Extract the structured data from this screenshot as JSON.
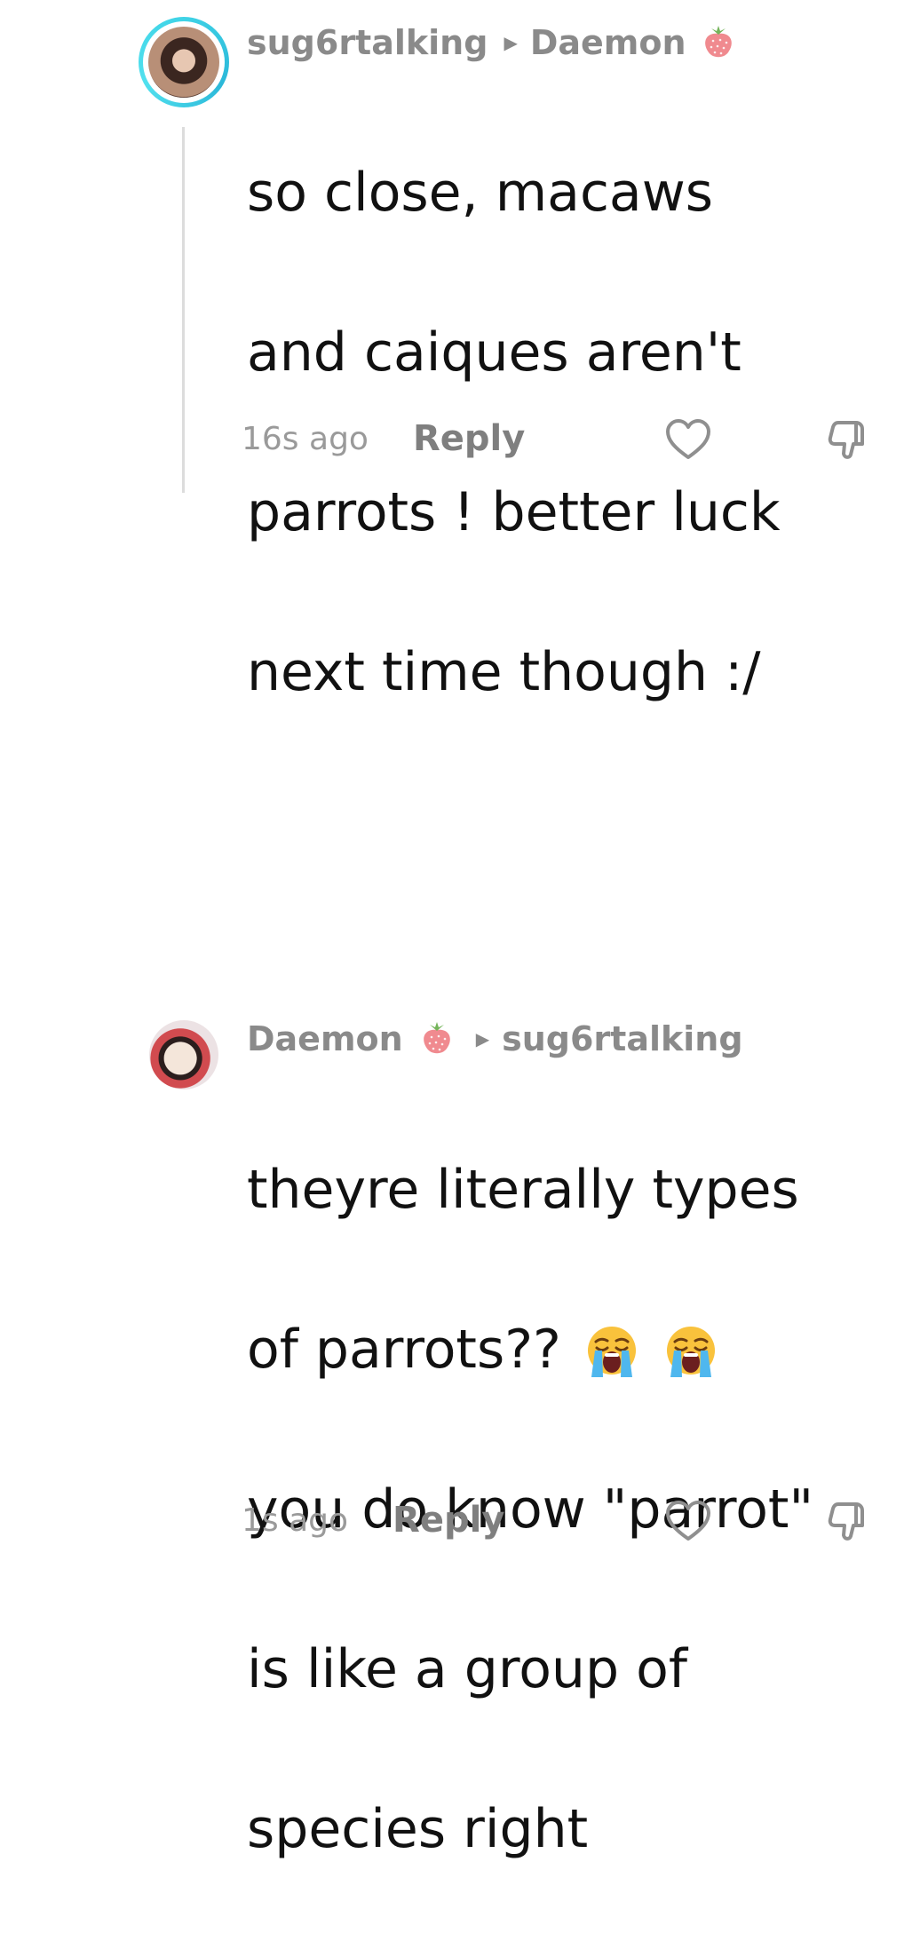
{
  "comments": [
    {
      "author": "sug6rtalking",
      "reply_to": "Daemon",
      "body_lines": [
        "so close, macaws",
        "and caiques aren't",
        "parrots ! better luck",
        "next time though :/"
      ],
      "time": "16s ago",
      "reply_label": "Reply"
    },
    {
      "author": "Daemon",
      "reply_to": "sug6rtalking",
      "body_lines": [
        "theyre literally types",
        "of parrots??",
        "you do know \"parrot\"",
        "is like a group of",
        "species right"
      ],
      "time": "1s ago",
      "reply_label": "Reply"
    }
  ],
  "icons": {
    "badge": "strawberry-icon",
    "emoji": "loudly-crying-face-icon",
    "like": "heart-outline-icon",
    "dislike": "thumbs-down-icon",
    "reply_arrow": "caret-right-icon"
  },
  "colors": {
    "avatar_ring": "#3fd3e6",
    "text": "#111111",
    "muted": "#8a8a8a",
    "thread_line": "#dcdcdc"
  }
}
